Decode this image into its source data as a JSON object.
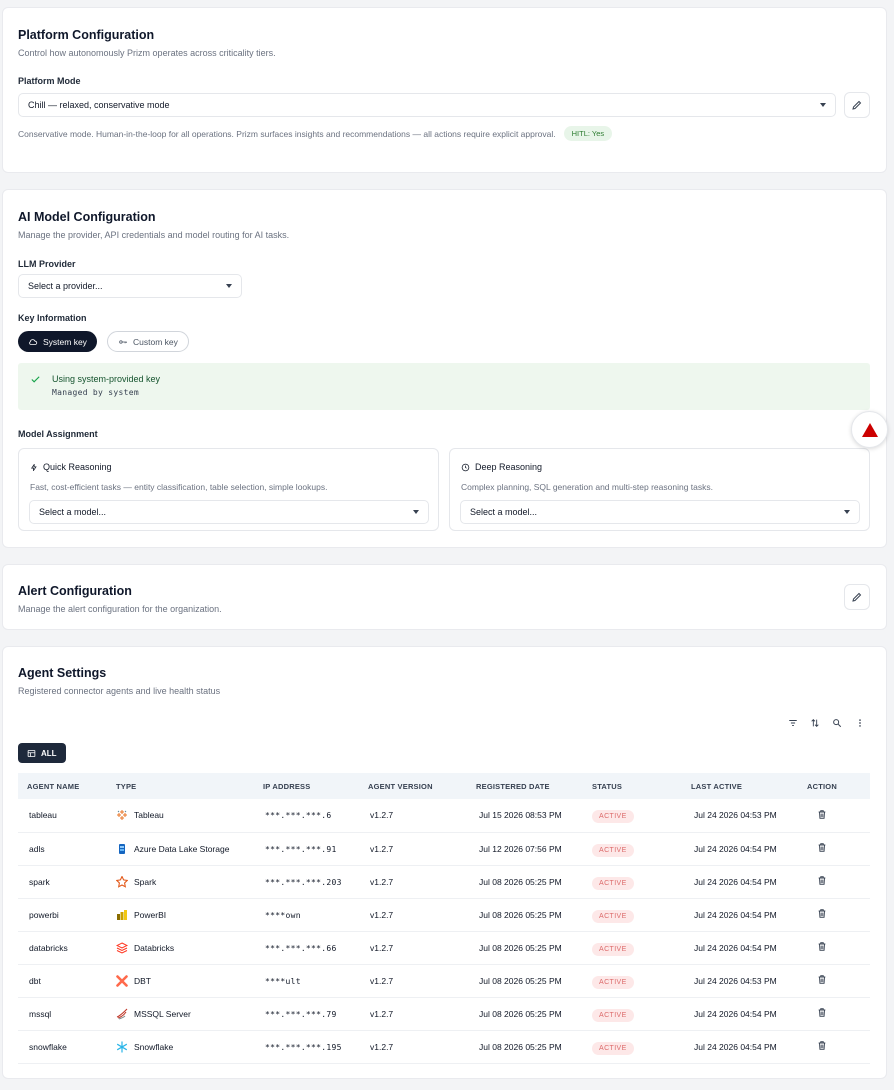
{
  "platform": {
    "title": "Platform Configuration",
    "description": "Control how autonomously Prizm operates across criticality tiers.",
    "mode_label": "Platform Mode",
    "mode_value": "Chill — relaxed, conservative mode",
    "mode_help": "Conservative mode. Human-in-the-loop for all operations. Prizm surfaces insights and recommendations — all actions require explicit approval.",
    "hitl_badge": "HITL: Yes"
  },
  "ai_model": {
    "title": "AI Model Configuration",
    "description": "Manage the provider, API credentials and model routing for AI tasks.",
    "provider_label": "LLM Provider",
    "provider_placeholder": "Select a provider...",
    "key_label": "Key Information",
    "key_options": [
      "System key",
      "Custom key"
    ],
    "key_selected": "System key",
    "key_status_title": "Using system-provided key",
    "key_status_sub": "Managed by system",
    "assignment_label": "Model Assignment",
    "quick": {
      "title": "Quick Reasoning",
      "description": "Fast, cost-efficient tasks — entity classification, table selection, simple lookups.",
      "placeholder": "Select a model..."
    },
    "deep": {
      "title": "Deep Reasoning",
      "description": "Complex planning, SQL generation and multi-step reasoning tasks.",
      "placeholder": "Select a model..."
    }
  },
  "alert": {
    "title": "Alert Configuration",
    "description": "Manage the alert configuration for the organization."
  },
  "agents": {
    "title": "Agent Settings",
    "description": "Registered connector agents and live health status",
    "filter_chip": "ALL",
    "columns": [
      "AGENT NAME",
      "TYPE",
      "IP ADDRESS",
      "AGENT VERSION",
      "REGISTERED DATE",
      "STATUS",
      "LAST ACTIVE",
      "ACTION"
    ],
    "rows": [
      {
        "name": "tableau",
        "type": "Tableau",
        "icon": "tableau-icon",
        "ip": "***.***.***.6",
        "version": "v1.2.7",
        "registered": "Jul 15 2026 08:53 PM",
        "status": "ACTIVE",
        "last_active": "Jul 24 2026 04:53 PM"
      },
      {
        "name": "adls",
        "type": "Azure Data Lake Storage",
        "icon": "adls-icon",
        "ip": "***.***.***.91",
        "version": "v1.2.7",
        "registered": "Jul 12 2026 07:56 PM",
        "status": "ACTIVE",
        "last_active": "Jul 24 2026 04:54 PM"
      },
      {
        "name": "spark",
        "type": "Spark",
        "icon": "spark-icon",
        "ip": "***.***.***.203",
        "version": "v1.2.7",
        "registered": "Jul 08 2026 05:25 PM",
        "status": "ACTIVE",
        "last_active": "Jul 24 2026 04:54 PM"
      },
      {
        "name": "powerbi",
        "type": "PowerBI",
        "icon": "powerbi-icon",
        "ip": "****own",
        "version": "v1.2.7",
        "registered": "Jul 08 2026 05:25 PM",
        "status": "ACTIVE",
        "last_active": "Jul 24 2026 04:54 PM"
      },
      {
        "name": "databricks",
        "type": "Databricks",
        "icon": "databricks-icon",
        "ip": "***.***.***.66",
        "version": "v1.2.7",
        "registered": "Jul 08 2026 05:25 PM",
        "status": "ACTIVE",
        "last_active": "Jul 24 2026 04:54 PM"
      },
      {
        "name": "dbt",
        "type": "DBT",
        "icon": "dbt-icon",
        "ip": "****ult",
        "version": "v1.2.7",
        "registered": "Jul 08 2026 05:25 PM",
        "status": "ACTIVE",
        "last_active": "Jul 24 2026 04:53 PM"
      },
      {
        "name": "mssql",
        "type": "MSSQL Server",
        "icon": "mssql-icon",
        "ip": "***.***.***.79",
        "version": "v1.2.7",
        "registered": "Jul 08 2026 05:25 PM",
        "status": "ACTIVE",
        "last_active": "Jul 24 2026 04:54 PM"
      },
      {
        "name": "snowflake",
        "type": "Snowflake",
        "icon": "snowflake-icon",
        "ip": "***.***.***.195",
        "version": "v1.2.7",
        "registered": "Jul 08 2026 05:25 PM",
        "status": "ACTIVE",
        "last_active": "Jul 24 2026 04:54 PM"
      }
    ]
  },
  "colors": {
    "primary_dark": "#0f172a",
    "success_bg": "#eef7ee",
    "success_icon": "#16a34a",
    "status_bg": "#fde8e8",
    "status_text": "#dc6a6a",
    "alert_red": "#cc0000"
  }
}
